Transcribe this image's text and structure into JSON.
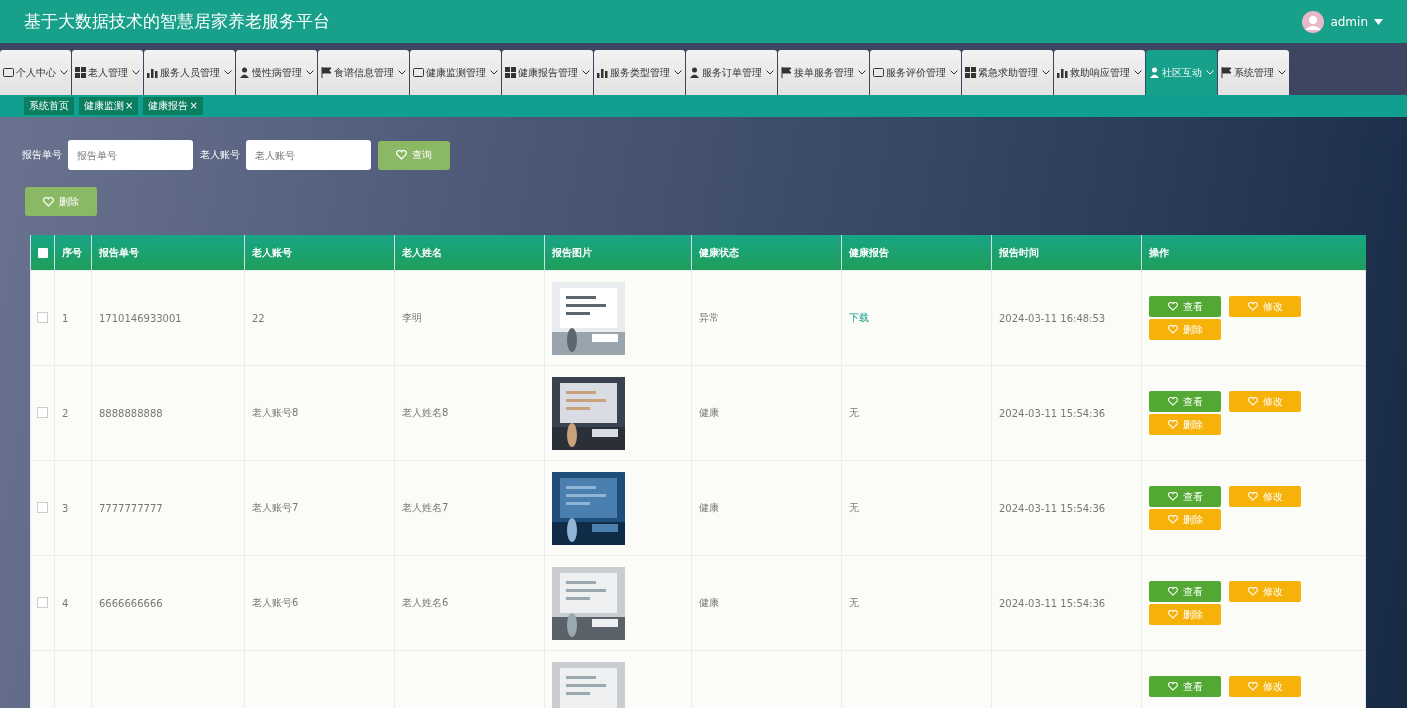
{
  "header": {
    "title": "基于大数据技术的智慧居家养老服务平台",
    "user": "admin"
  },
  "nav": [
    {
      "label": "个人中心",
      "selected": false
    },
    {
      "label": "老人管理",
      "selected": false
    },
    {
      "label": "服务人员管理",
      "selected": false
    },
    {
      "label": "慢性病管理",
      "selected": false
    },
    {
      "label": "食谱信息管理",
      "selected": false
    },
    {
      "label": "健康监测管理",
      "selected": false
    },
    {
      "label": "健康报告管理",
      "selected": false
    },
    {
      "label": "服务类型管理",
      "selected": false
    },
    {
      "label": "服务订单管理",
      "selected": false
    },
    {
      "label": "接单服务管理",
      "selected": false
    },
    {
      "label": "服务评价管理",
      "selected": false
    },
    {
      "label": "紧急求助管理",
      "selected": false
    },
    {
      "label": "救助响应管理",
      "selected": false
    },
    {
      "label": "社区互动",
      "selected": true
    },
    {
      "label": "系统管理",
      "selected": false
    }
  ],
  "breadcrumbs": [
    {
      "label": "系统首页"
    },
    {
      "label": "健康监测",
      "close": "×"
    },
    {
      "label": "健康报告",
      "close": "×"
    }
  ],
  "search": {
    "fields": [
      {
        "label": "报告单号",
        "placeholder": "报告单号"
      },
      {
        "label": "老人账号",
        "placeholder": "老人账号"
      }
    ],
    "button": "查询"
  },
  "delete_button": "删除",
  "table": {
    "header_checked": false,
    "columns": [
      "序号",
      "报告单号",
      "老人账号",
      "老人姓名",
      "报告图片",
      "健康状态",
      "健康报告",
      "报告时间",
      "操作"
    ],
    "rows": [
      {
        "checked": false,
        "index": "1",
        "report_no": "1710146933001",
        "account": "22",
        "name": "李明",
        "status": "异常",
        "report": "下载",
        "report_link": true,
        "time": "2024-03-11 16:48:53",
        "actions": [
          {
            "label": "查看",
            "kind": "view"
          },
          {
            "label": "修改",
            "kind": "edit"
          },
          {
            "label": "删除",
            "kind": "delete"
          }
        ]
      },
      {
        "checked": false,
        "index": "2",
        "report_no": "8888888888",
        "account": "老人账号8",
        "name": "老人姓名8",
        "status": "健康",
        "report": "无",
        "report_link": false,
        "time": "2024-03-11 15:54:36",
        "actions": [
          {
            "label": "查看",
            "kind": "view"
          },
          {
            "label": "修改",
            "kind": "edit"
          },
          {
            "label": "删除",
            "kind": "delete"
          }
        ]
      },
      {
        "checked": false,
        "index": "3",
        "report_no": "7777777777",
        "account": "老人账号7",
        "name": "老人姓名7",
        "status": "健康",
        "report": "无",
        "report_link": false,
        "time": "2024-03-11 15:54:36",
        "actions": [
          {
            "label": "查看",
            "kind": "view"
          },
          {
            "label": "修改",
            "kind": "edit"
          },
          {
            "label": "删除",
            "kind": "delete"
          }
        ]
      },
      {
        "checked": false,
        "index": "4",
        "report_no": "6666666666",
        "account": "老人账号6",
        "name": "老人姓名6",
        "status": "健康",
        "report": "无",
        "report_link": false,
        "time": "2024-03-11 15:54:36",
        "actions": [
          {
            "label": "查看",
            "kind": "view"
          },
          {
            "label": "修改",
            "kind": "edit"
          },
          {
            "label": "删除",
            "kind": "delete"
          }
        ]
      },
      {
        "actions": [
          {
            "label": "查看",
            "kind": "view"
          },
          {
            "label": "修改",
            "kind": "edit"
          }
        ]
      }
    ]
  }
}
